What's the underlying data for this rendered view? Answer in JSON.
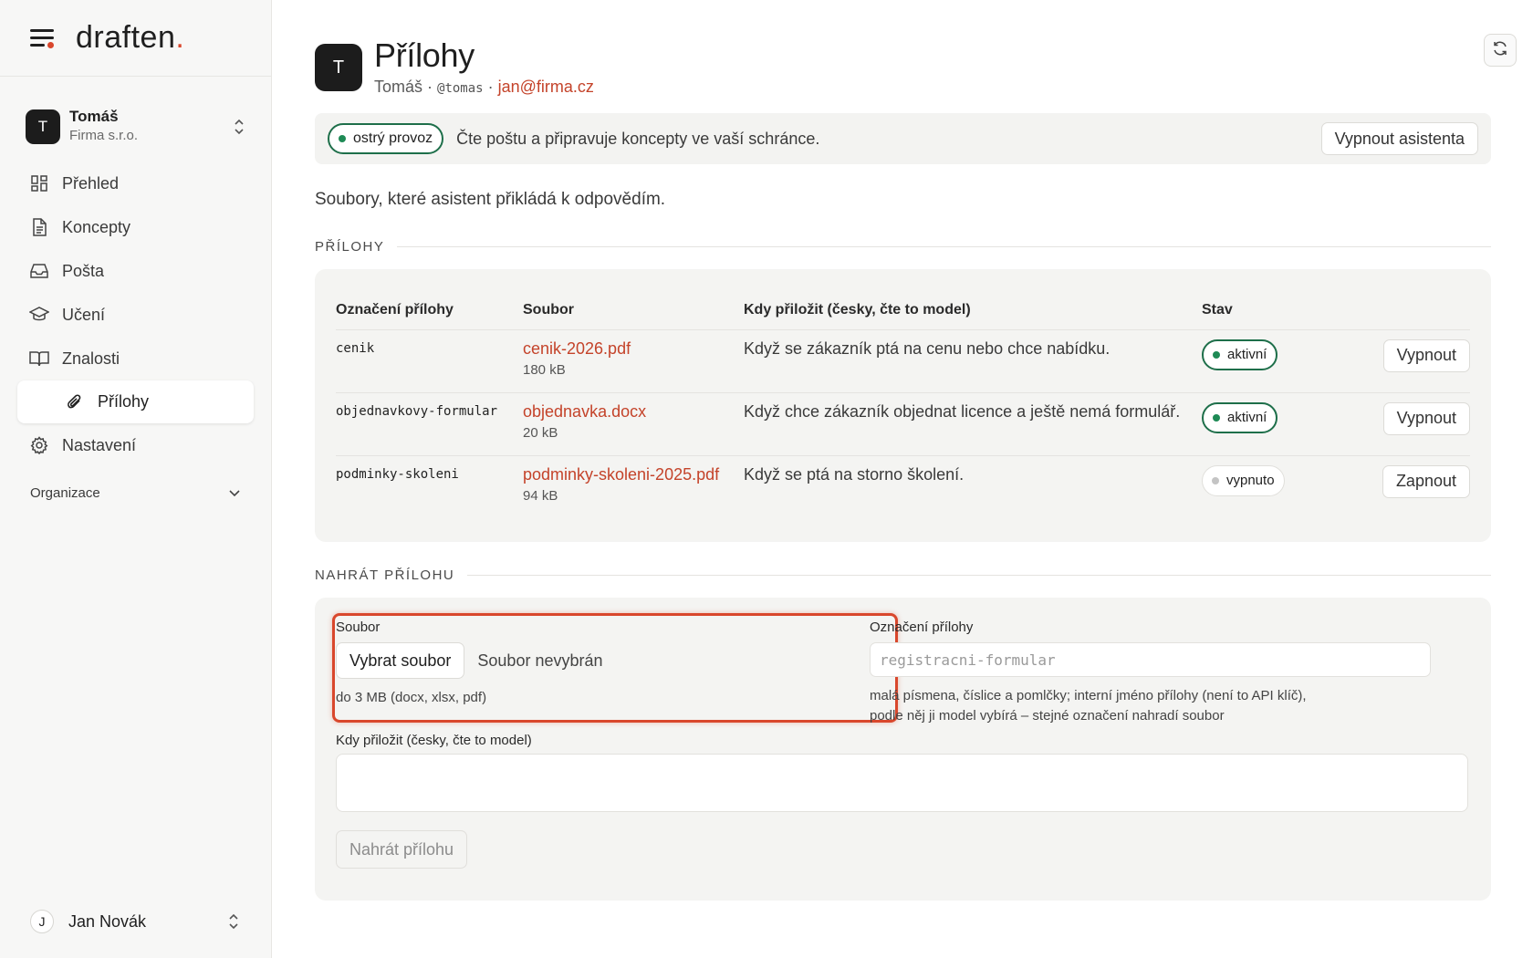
{
  "brand": {
    "name": "draften",
    "dot": ".",
    "menu_icon": "menu-icon"
  },
  "account": {
    "initial": "T",
    "name": "Tomáš",
    "company": "Firma s.r.o."
  },
  "nav": {
    "items": [
      {
        "label": "Přehled",
        "icon": "dashboard-icon"
      },
      {
        "label": "Koncepty",
        "icon": "document-icon"
      },
      {
        "label": "Pošta",
        "icon": "inbox-icon"
      },
      {
        "label": "Učení",
        "icon": "graduation-cap-icon"
      },
      {
        "label": "Znalosti",
        "icon": "book-icon"
      }
    ],
    "sub_item": {
      "label": "Přílohy",
      "icon": "paperclip-icon"
    },
    "settings": {
      "label": "Nastavení",
      "icon": "gear-icon"
    },
    "organization": "Organizace"
  },
  "user": {
    "initial": "J",
    "name": "Jan Novák"
  },
  "header": {
    "initial": "T",
    "title": "Přílohy",
    "name": "Tomáš",
    "sep1": " · ",
    "handle": "@tomas",
    "sep2": " · ",
    "email": "jan@firma.cz"
  },
  "status": {
    "badge": "ostrý provoz",
    "text": "Čte poštu a připravuje koncepty ve vaší schránce.",
    "disable_button": "Vypnout asistenta"
  },
  "intro": "Soubory, které asistent přikládá k odpovědím.",
  "attachments": {
    "section_title": "PŘÍLOHY",
    "columns": [
      "Označení přílohy",
      "Soubor",
      "Kdy přiložit (česky, čte to model)",
      "Stav",
      ""
    ],
    "rows": [
      {
        "label": "cenik",
        "file": "cenik-2026.pdf",
        "size": "180 kB",
        "when": "Když se zákazník ptá na cenu nebo chce nabídku.",
        "state": "aktivní",
        "active": true,
        "action": "Vypnout"
      },
      {
        "label": "objednavkovy-formular",
        "file": "objednavka.docx",
        "size": "20 kB",
        "when": "Když chce zákazník objednat licence a ještě nemá formulář.",
        "state": "aktivní",
        "active": true,
        "action": "Vypnout"
      },
      {
        "label": "podminky-skoleni",
        "file": "podminky-skoleni-2025.pdf",
        "size": "94 kB",
        "when": "Když se ptá na storno školení.",
        "state": "vypnuto",
        "active": false,
        "action": "Zapnout"
      }
    ]
  },
  "upload": {
    "section_title": "NAHRÁT PŘÍLOHU",
    "file_label": "Soubor",
    "choose_button": "Vybrat soubor",
    "no_file": "Soubor nevybrán",
    "file_hint": "do 3 MB (docx, xlsx, pdf)",
    "name_label": "Označení přílohy",
    "name_placeholder": "registracni-formular",
    "name_hint_1": "malá písmena, číslice a pomlčky; interní jméno přílohy (není to API klíč),",
    "name_hint_2": "podle něj ji model vybírá – stejné označení nahradí soubor",
    "when_label": "Kdy přiložit (česky, čte to model)",
    "when_value": "",
    "submit_button": "Nahrát přílohu"
  },
  "colors": {
    "accent": "#d9472c",
    "link": "#c4432a",
    "active_green": "#1e6f4a"
  }
}
